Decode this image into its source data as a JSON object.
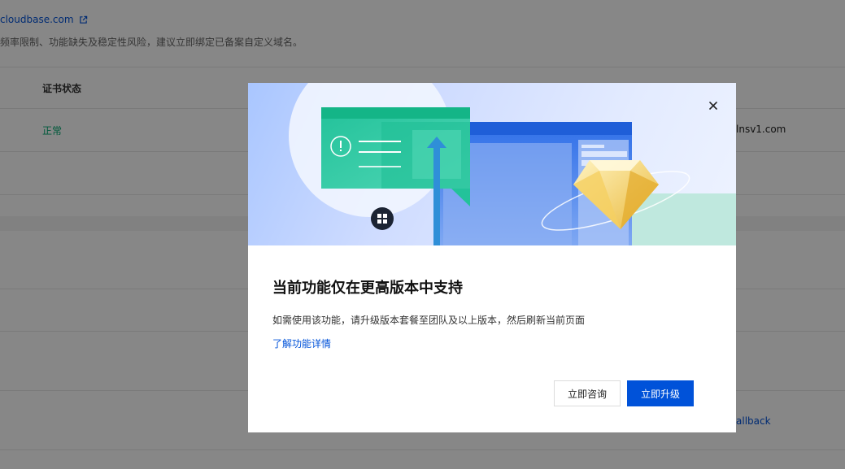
{
  "background": {
    "domain_link": "cloudbase.com",
    "domain_note": "频率限制、功能缺失及稳定性风险，建议立即绑定已备案自定义域名。",
    "table": {
      "cert_status_header": "证书状态",
      "cert_status_value": "正常",
      "dns_value": "lnsv1.com",
      "fallback_link": "allback"
    }
  },
  "dialog": {
    "title": "当前功能仅在更高版本中支持",
    "description": "如需使用该功能，请升级版本套餐至团队及以上版本，然后刷新当前页面",
    "learn_more": "了解功能详情",
    "consult_button": "立即咨询",
    "upgrade_button": "立即升级"
  },
  "colors": {
    "primary": "#0052d9",
    "success": "#00a870",
    "banner_teal": "#2bc5a3"
  }
}
